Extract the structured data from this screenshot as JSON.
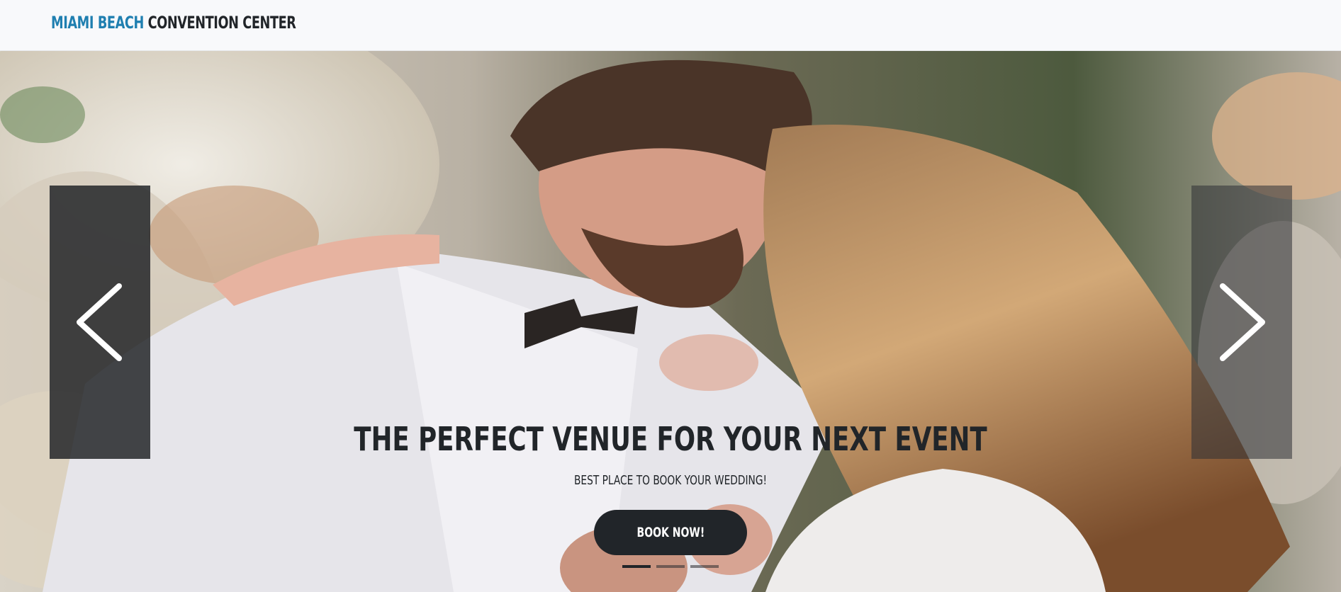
{
  "brand": {
    "accent": "MIAMI BEACH",
    "rest": " CONVENTION CENTER",
    "accent_color": "#1f7fb0"
  },
  "carousel": {
    "headline": "THE PERFECT VENUE FOR YOUR NEXT EVENT",
    "subline": "BEST PLACE TO BOOK YOUR WEDDING!",
    "cta_label": "BOOK NOW!",
    "prev_icon": "chevron-left-icon",
    "next_icon": "chevron-right-icon",
    "slide_count": 3,
    "active_slide": 1
  },
  "colors": {
    "dark": "#212529",
    "navbar_bg": "#f8f9fb"
  }
}
